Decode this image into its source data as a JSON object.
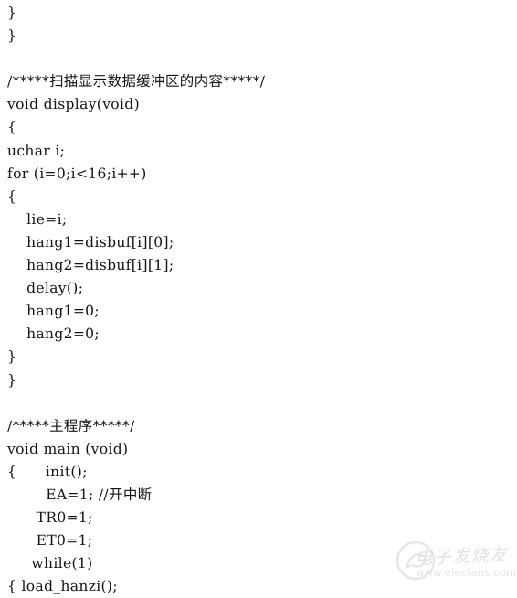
{
  "document": {
    "type": "c-source-code-listing",
    "background_color": "#ffffff",
    "text_color": "#131313",
    "lines": [
      "}",
      "}",
      "",
      "/*****扫描显示数据缓冲区的内容*****/",
      "void display(void)",
      "{",
      "uchar i;",
      "for (i=0;i<16;i++)",
      "{",
      "    lie=i;",
      "    hang1=disbuf[i][0];",
      "    hang2=disbuf[i][1];",
      "    delay();",
      "    hang1=0;",
      "    hang2=0;",
      "}",
      "}",
      "",
      "/*****主程序*****/",
      "void main (void)",
      "{      init();",
      "        EA=1; //开中断",
      "      TR0=1;",
      "      ET0=1;",
      "     while(1)",
      "{ load_hanzi();"
    ]
  },
  "watermark": {
    "brand_cn": "电子发烧友",
    "url": "www.elecfans.com",
    "color": "#e3e3e3"
  }
}
